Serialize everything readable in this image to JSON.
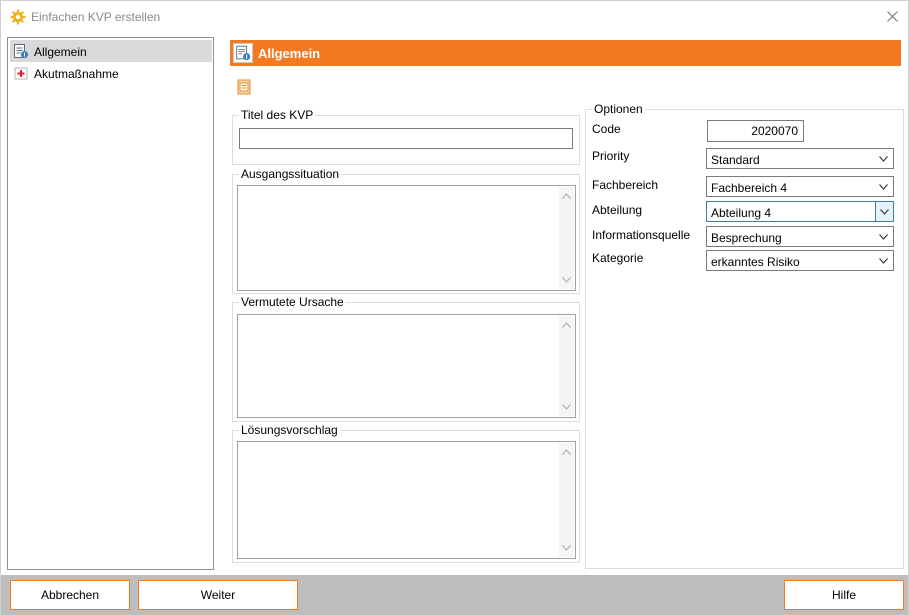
{
  "window": {
    "title": "Einfachen KVP erstellen"
  },
  "nav": {
    "items": [
      {
        "label": "Allgemein",
        "icon": "form-doc-icon",
        "selected": true
      },
      {
        "label": "Akutmaßnahme",
        "icon": "first-aid-icon",
        "selected": false
      }
    ]
  },
  "header": {
    "title": "Allgemein"
  },
  "groups": {
    "titel": {
      "label": "Titel des KVP",
      "value": ""
    },
    "ausgang": {
      "label": "Ausgangssituation",
      "value": ""
    },
    "ursache": {
      "label": "Vermutete Ursache",
      "value": ""
    },
    "loesung": {
      "label": "Lösungsvorschlag",
      "value": ""
    }
  },
  "options": {
    "label": "Optionen",
    "code_label": "Code",
    "code_value": "2020070",
    "priority_label": "Priority",
    "priority_value": "Standard",
    "fachbereich_label": "Fachbereich",
    "fachbereich_value": "Fachbereich 4",
    "abteilung_label": "Abteilung",
    "abteilung_value": "Abteilung 4",
    "info_label": "Informationsquelle",
    "info_value": "Besprechung",
    "kategorie_label": "Kategorie",
    "kategorie_value": "erkanntes Risiko"
  },
  "footer": {
    "cancel_label": "Abbrechen",
    "next_label": "Weiter",
    "help_label": "Hilfe"
  },
  "colors": {
    "accent": "#f47a22",
    "footer_bg": "#bdbdbd",
    "selection": "#d9d9d9"
  }
}
